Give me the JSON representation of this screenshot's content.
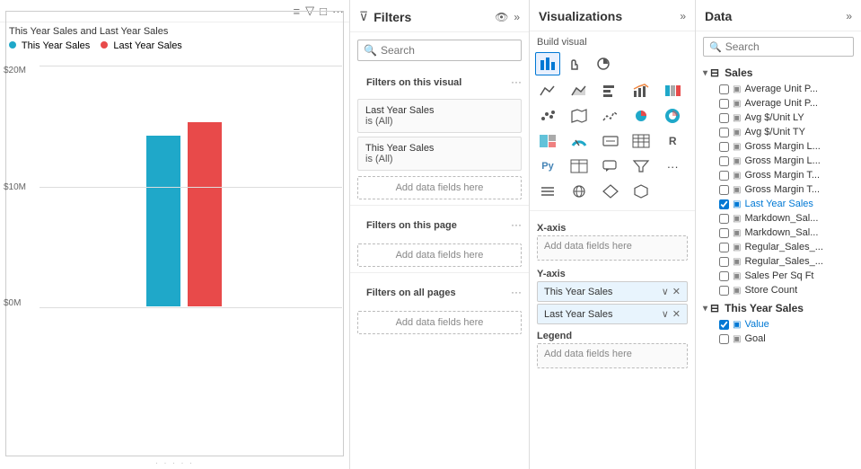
{
  "chart": {
    "title": "This Year Sales and Last Year Sales",
    "legend": [
      {
        "label": "This Year Sales",
        "color": "#1fa8c9"
      },
      {
        "label": "Last Year Sales",
        "color": "#e84a4a"
      }
    ],
    "y_labels": [
      "$20M",
      "$10M",
      "$0M"
    ],
    "toolbar_icons": [
      "≡",
      "▽",
      "□",
      "..."
    ]
  },
  "filters": {
    "title": "Filters",
    "search_placeholder": "Search",
    "section_visual": "Filters on this visual",
    "section_page": "Filters on this page",
    "section_all": "Filters on all pages",
    "filter_items": [
      {
        "title": "Last Year Sales",
        "sub": "is (All)"
      },
      {
        "title": "This Year Sales",
        "sub": "is (All)"
      }
    ],
    "add_fields": "Add data fields here"
  },
  "visualizations": {
    "title": "Visualizations",
    "build_label": "Build visual",
    "x_axis_label": "X-axis",
    "y_axis_label": "Y-axis",
    "legend_label": "Legend",
    "x_axis_placeholder": "Add data fields here",
    "y_axis_items": [
      {
        "label": "This Year Sales"
      },
      {
        "label": "Last Year Sales"
      }
    ],
    "legend_placeholder": "Add data fields here"
  },
  "data": {
    "title": "Data",
    "search_placeholder": "Search",
    "groups": [
      {
        "name": "Sales",
        "expanded": true,
        "items": [
          {
            "label": "Average Unit P...",
            "checked": false
          },
          {
            "label": "Average Unit P...",
            "checked": false
          },
          {
            "label": "Avg $/Unit LY",
            "checked": false
          },
          {
            "label": "Avg $/Unit TY",
            "checked": false
          },
          {
            "label": "Gross Margin L...",
            "checked": false
          },
          {
            "label": "Gross Margin L...",
            "checked": false
          },
          {
            "label": "Gross Margin T...",
            "checked": false
          },
          {
            "label": "Gross Margin T...",
            "checked": false
          },
          {
            "label": "Last Year Sales",
            "checked": true
          },
          {
            "label": "Markdown_Sal...",
            "checked": false
          },
          {
            "label": "Markdown_Sal...",
            "checked": false
          },
          {
            "label": "Regular_Sales_...",
            "checked": false
          },
          {
            "label": "Regular_Sales_...",
            "checked": false
          },
          {
            "label": "Sales Per Sq Ft",
            "checked": false
          },
          {
            "label": "Store Count",
            "checked": false
          }
        ]
      },
      {
        "name": "This Year Sales",
        "expanded": true,
        "items": [
          {
            "label": "Value",
            "checked": true
          },
          {
            "label": "Goal",
            "checked": false
          }
        ]
      }
    ]
  }
}
